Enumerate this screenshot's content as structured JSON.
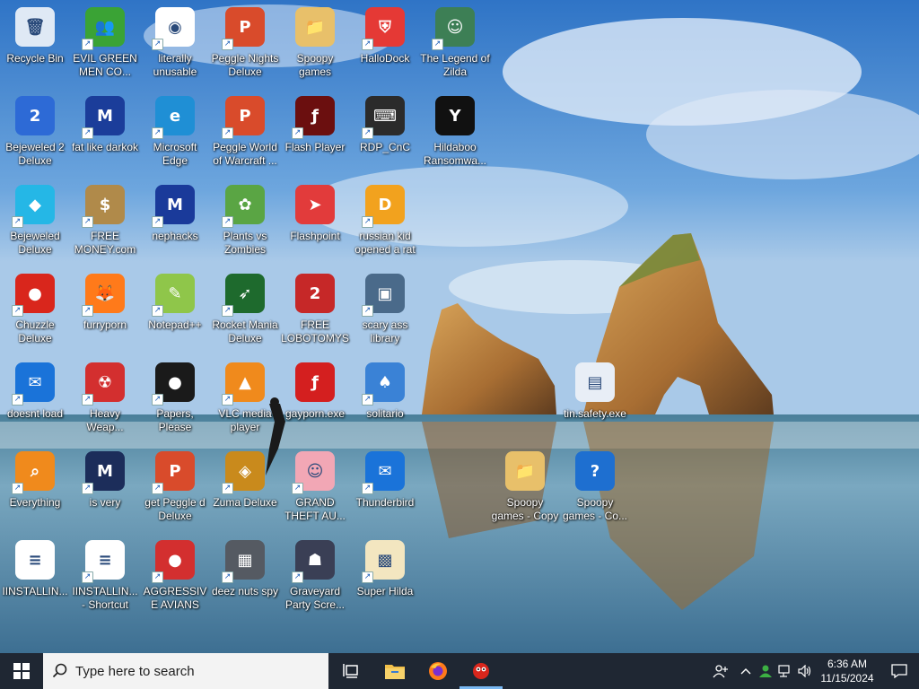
{
  "desktop": {
    "icons": [
      {
        "label": "Recycle Bin",
        "icon": "recycle-bin-icon",
        "shortcut": false,
        "color": "#dfe9f5",
        "glyph": "🗑"
      },
      {
        "label": "EVIL GREEN MEN CO...",
        "icon": "green-men-icon",
        "shortcut": true,
        "color": "#3aa335",
        "glyph": "👥"
      },
      {
        "label": "literally unusable",
        "icon": "chrome-icon",
        "shortcut": true,
        "color": "#ffffff",
        "glyph": "◉"
      },
      {
        "label": "Peggle Nights Deluxe",
        "icon": "peggle-nights-icon",
        "shortcut": true,
        "color": "#d94b2b",
        "glyph": "P"
      },
      {
        "label": "Spoopy games",
        "icon": "folder-icon",
        "shortcut": false,
        "color": "#e8c06a",
        "glyph": "📁"
      },
      {
        "label": "HalloDock",
        "icon": "shield-icon",
        "shortcut": true,
        "color": "#e53935",
        "glyph": "⛨"
      },
      {
        "label": "The Legend of Zilda",
        "icon": "zilda-icon",
        "shortcut": true,
        "color": "#3d7f55",
        "glyph": "☺"
      },
      {
        "label": "Bejeweled 2 Deluxe",
        "icon": "bejeweled2-icon",
        "shortcut": false,
        "color": "#2d6ad6",
        "glyph": "2"
      },
      {
        "label": "fat like darkok",
        "icon": "mpl-icon",
        "shortcut": true,
        "color": "#1b3d9a",
        "glyph": "M"
      },
      {
        "label": "Microsoft Edge",
        "icon": "edge-icon",
        "shortcut": true,
        "color": "#1f8fd5",
        "glyph": "e"
      },
      {
        "label": "Peggle World of Warcraft ...",
        "icon": "peggle-wow-icon",
        "shortcut": true,
        "color": "#d94b2b",
        "glyph": "P"
      },
      {
        "label": "Flash Player",
        "icon": "flash-icon",
        "shortcut": true,
        "color": "#6b0f0f",
        "glyph": "ƒ"
      },
      {
        "label": "RDP_CnC",
        "icon": "rdp-icon",
        "shortcut": true,
        "color": "#2b2b2b",
        "glyph": "⌨"
      },
      {
        "label": "Hildaboo Ransomwa...",
        "icon": "yashma-icon",
        "shortcut": false,
        "color": "#111111",
        "glyph": "Y"
      },
      {
        "label": "Bejeweled Deluxe",
        "icon": "gem-icon",
        "shortcut": true,
        "color": "#25b7e6",
        "glyph": "◆"
      },
      {
        "label": "FREE MONEY.com",
        "icon": "money-bag-icon",
        "shortcut": true,
        "color": "#b08a4a",
        "glyph": "$"
      },
      {
        "label": "nephacks",
        "icon": "mpi-icon",
        "shortcut": true,
        "color": "#1a3a9a",
        "glyph": "M"
      },
      {
        "label": "Plants vs Zombies",
        "icon": "pvz-icon",
        "shortcut": true,
        "color": "#5aa544",
        "glyph": "✿"
      },
      {
        "label": "Flashpoint",
        "icon": "flashpoint-icon",
        "shortcut": false,
        "color": "#e23b3b",
        "glyph": "➤"
      },
      {
        "label": "russian kid opened a rat",
        "icon": "de-icon",
        "shortcut": true,
        "color": "#f2a21e",
        "glyph": "D"
      },
      {
        "label": "Chuzzle Deluxe",
        "icon": "chuzzle-icon",
        "shortcut": true,
        "color": "#d9261c",
        "glyph": "●"
      },
      {
        "label": "furryporn",
        "icon": "firefox-icon",
        "shortcut": true,
        "color": "#ff7a1a",
        "glyph": "🦊"
      },
      {
        "label": "Notepad++",
        "icon": "notepadpp-icon",
        "shortcut": true,
        "color": "#8fc64a",
        "glyph": "✎"
      },
      {
        "label": "Rocket Mania Deluxe",
        "icon": "rocket-icon",
        "shortcut": true,
        "color": "#1e6a2d",
        "glyph": "➶"
      },
      {
        "label": "FREE LOBOTOMYS",
        "icon": "lobotomy-icon",
        "shortcut": false,
        "color": "#c62828",
        "glyph": "2"
      },
      {
        "label": "scary ass library",
        "icon": "library-icon",
        "shortcut": true,
        "color": "#4a6a8a",
        "glyph": "▣"
      },
      {
        "label": "doesnt load",
        "icon": "thunderbird-icon",
        "shortcut": true,
        "color": "#1a73d9",
        "glyph": "✉"
      },
      {
        "label": "Heavy Weap...",
        "icon": "radiation-icon",
        "shortcut": true,
        "color": "#d32f2f",
        "glyph": "☢"
      },
      {
        "label": "Papers, Please",
        "icon": "papers-please-icon",
        "shortcut": true,
        "color": "#1a1a1a",
        "glyph": "●"
      },
      {
        "label": "VLC media player",
        "icon": "vlc-icon",
        "shortcut": true,
        "color": "#f08a1c",
        "glyph": "▲"
      },
      {
        "label": "gayporn.exe",
        "icon": "flash-exe-icon",
        "shortcut": false,
        "color": "#d41f1f",
        "glyph": "ƒ"
      },
      {
        "label": "solitario",
        "icon": "solitaire-icon",
        "shortcut": true,
        "color": "#3a82d6",
        "glyph": "♠"
      },
      {
        "label": "tin.safety.exe",
        "icon": "window-app-icon",
        "shortcut": false,
        "color": "#e8eef6",
        "glyph": "▤"
      },
      {
        "label": "Everything",
        "icon": "everything-search-icon",
        "shortcut": true,
        "color": "#f08a1c",
        "glyph": "⌕"
      },
      {
        "label": "is very",
        "icon": "mpl-shield-icon",
        "shortcut": true,
        "color": "#1c2d5a",
        "glyph": "M"
      },
      {
        "label": "get Peggle d Deluxe",
        "icon": "peggle-deluxe-icon",
        "shortcut": true,
        "color": "#d94b2b",
        "glyph": "P"
      },
      {
        "label": "Zuma Deluxe",
        "icon": "zuma-icon",
        "shortcut": true,
        "color": "#c98a1c",
        "glyph": "◈"
      },
      {
        "label": "GRAND THEFT AU...",
        "icon": "anime-girl-icon",
        "shortcut": true,
        "color": "#f2a7b5",
        "glyph": "☺"
      },
      {
        "label": "Thunderbird",
        "icon": "thunderbird2-icon",
        "shortcut": true,
        "color": "#1a73d9",
        "glyph": "✉"
      },
      {
        "label": "Spoopy games - Copy",
        "icon": "folder-copy-icon",
        "shortcut": false,
        "color": "#e8c06a",
        "glyph": "📁"
      },
      {
        "label": "Spoopy games - Co...",
        "icon": "unknown-file-icon",
        "shortcut": false,
        "color": "#1e6fd0",
        "glyph": "?"
      },
      {
        "label": "IINSTALLIN...",
        "icon": "text-file-icon",
        "shortcut": false,
        "color": "#ffffff",
        "glyph": "≡"
      },
      {
        "label": "IINSTALLIN... - Shortcut",
        "icon": "text-shortcut-icon",
        "shortcut": true,
        "color": "#ffffff",
        "glyph": "≡"
      },
      {
        "label": "AGGRESSIVE AVIANS",
        "icon": "angry-bird-icon",
        "shortcut": true,
        "color": "#d32f2f",
        "glyph": "●"
      },
      {
        "label": "deez nuts spy",
        "icon": "stack-icon",
        "shortcut": true,
        "color": "#555a62",
        "glyph": "▦"
      },
      {
        "label": "Graveyard Party Scre...",
        "icon": "graveyard-icon",
        "shortcut": true,
        "color": "#3a3f55",
        "glyph": "☗"
      },
      {
        "label": "Super Hilda",
        "icon": "pixel-dog-icon",
        "shortcut": true,
        "color": "#f3e6c0",
        "glyph": "▩"
      }
    ]
  },
  "taskbar": {
    "search_placeholder": "Type here to search",
    "clock_time": "6:36 AM",
    "clock_date": "11/15/2024",
    "apps": [
      {
        "name": "task-view-icon"
      },
      {
        "name": "file-explorer-icon"
      },
      {
        "name": "firefox-icon"
      },
      {
        "name": "chuzzle-app-icon"
      }
    ]
  }
}
